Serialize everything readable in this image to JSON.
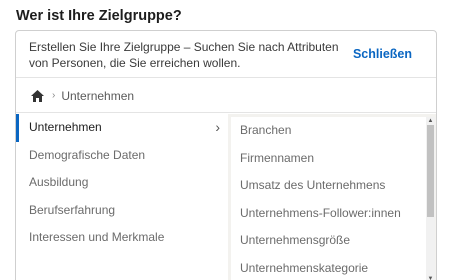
{
  "heading": "Wer ist Ihre Zielgruppe?",
  "intro": {
    "text": "Erstellen Sie Ihre Zielgruppe – Suchen Sie nach Attributen von Personen, die Sie erreichen wollen.",
    "close_label": "Schließen"
  },
  "breadcrumb": {
    "home_icon": "home-icon",
    "current": "Unternehmen"
  },
  "categories": [
    {
      "label": "Unternehmen",
      "selected": true
    },
    {
      "label": "Demografische Daten",
      "selected": false
    },
    {
      "label": "Ausbildung",
      "selected": false
    },
    {
      "label": "Berufserfahrung",
      "selected": false
    },
    {
      "label": "Interessen und Merkmale",
      "selected": false
    }
  ],
  "subcategories": [
    "Branchen",
    "Firmennamen",
    "Umsatz des Unternehmens",
    "Unternehmens-Follower:innen",
    "Unternehmensgröße",
    "Unternehmenskategorie"
  ],
  "colors": {
    "accent": "#0a66c2",
    "right_pane_bg": "#f3f2ef"
  },
  "selected_chevron": "›"
}
